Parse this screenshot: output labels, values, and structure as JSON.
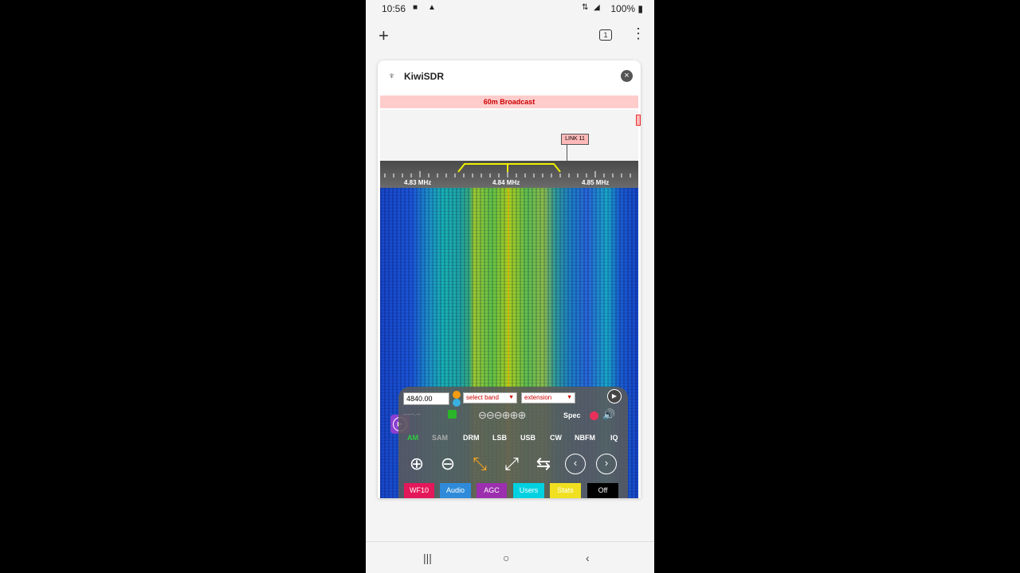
{
  "status_bar": {
    "time": "10:56",
    "right_text": "100%",
    "notification_icons": [
      "video-icon",
      "bell-icon"
    ],
    "system_icons": [
      "lte-icon",
      "signal-icon",
      "battery-icon"
    ]
  },
  "browser": {
    "new_tab_icon": "+",
    "tab_count": "1",
    "menu_icon": "⋮"
  },
  "site": {
    "title": "KiwiSDR",
    "close_icon": "×"
  },
  "spectrum": {
    "band_label": "60m Broadcast",
    "marker_label": "LINK 11",
    "scale_labels": [
      "4.83 MHz",
      "4.84 MHz",
      "4.85 MHz"
    ]
  },
  "controls": {
    "frequency": "4840.00",
    "band_select": "select band",
    "extension_select": "extension",
    "spec_label": "Spec",
    "modes": [
      "AM",
      "SAM",
      "DRM",
      "LSB",
      "USB",
      "CW",
      "NBFM",
      "IQ"
    ],
    "active_mode": "AM",
    "tabs": [
      {
        "label": "WF10",
        "color": "#e4175a"
      },
      {
        "label": "Audio",
        "color": "#2f8bd9"
      },
      {
        "label": "AGC",
        "color": "#9b2fae"
      },
      {
        "label": "Users",
        "color": "#00d1e0"
      },
      {
        "label": "Stats",
        "color": "#f0e020"
      },
      {
        "label": "Off",
        "color": "#000000"
      }
    ]
  },
  "nav": {
    "recents": "|||",
    "home": "○",
    "back": "‹"
  }
}
